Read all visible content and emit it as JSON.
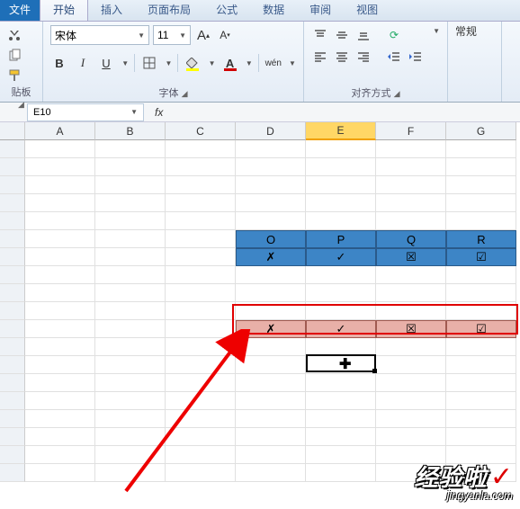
{
  "tabs": {
    "file": "文件",
    "home": "开始",
    "insert": "插入",
    "layout": "页面布局",
    "formulas": "公式",
    "data": "数据",
    "review": "审阅",
    "view": "视图"
  },
  "ribbon": {
    "clipboard_label": "贴板",
    "font_label": "字体",
    "align_label": "对齐方式",
    "number_label": "常规",
    "font_name": "宋体",
    "font_size": "11",
    "grow_font": "A",
    "shrink_font": "A",
    "bold": "B",
    "italic": "I",
    "underline": "U",
    "fill": "A",
    "font_color": "A",
    "pinyin": "wén"
  },
  "name_box": "E10",
  "fx_label": "fx",
  "columns": [
    "A",
    "B",
    "C",
    "D",
    "E",
    "F",
    "G"
  ],
  "selected_col_index": 4,
  "blue_table": {
    "headers": [
      "O",
      "P",
      "Q",
      "R"
    ],
    "row": [
      "✗",
      "✓",
      "☒",
      "☑"
    ]
  },
  "pink_row": [
    "✗",
    "✓",
    "☒",
    "☑"
  ],
  "active_cell": "E10",
  "watermark": {
    "main": "经验啦",
    "check": "✓",
    "sub": "jingyanla.com"
  }
}
